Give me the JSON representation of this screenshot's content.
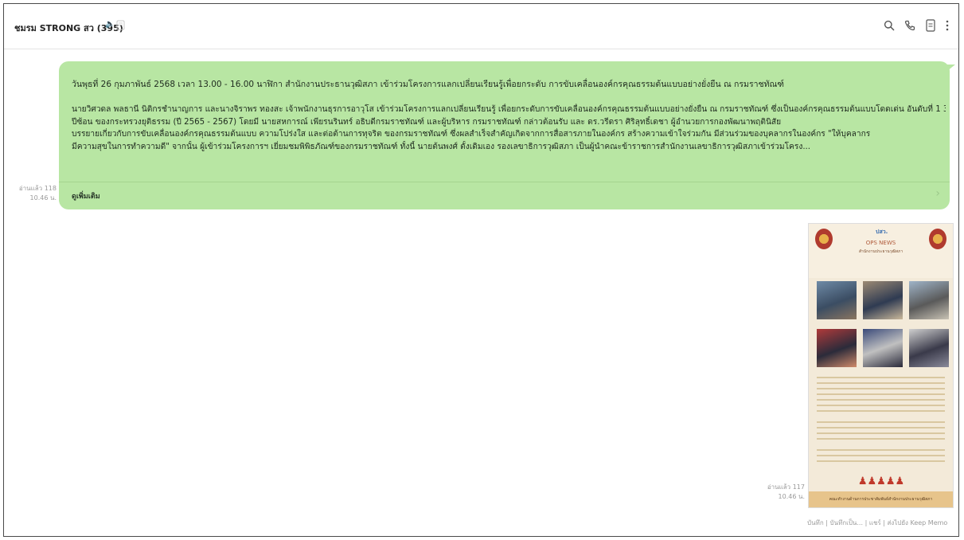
{
  "header": {
    "title": "ชมรม STRONG สว (395)",
    "icons": [
      "search-icon",
      "phone-icon",
      "note-icon",
      "more-icon"
    ]
  },
  "message": {
    "date_line": "วันพุธที่ 26 กุมภาพันธ์ 2568 เวลา 13.00 - 16.00 นาฬิกา สำนักงานประธานวุฒิสภา เข้าร่วมโครงการแลกเปลี่ยนเรียนรู้เพื่อยกระดับ การขับเคลื่อนองค์กรคุณธรรมต้นแบบอย่างยั่งยืน ณ กรมราชทัณฑ์",
    "lines": [
      "นายวิศวดล พลธานี นิติกรชำนาญการ และนางจิราพร ทองสะ เจ้าพนักงานธุรการอาวุโส เข้าร่วมโครงการแลกเปลี่ยนเรียนรู้ เพื่อยกระดับการขับเคลื่อนองค์กรคุณธรรมต้นแบบอย่างยั่งยืน ณ กรมราชทัณฑ์ ซึ่งเป็นองค์กรคุณธรรมต้นแบบโดดเด่น อันดับที่ 1 3",
      "ปีซ้อน ของกระทรวงยุติธรรม (ปี 2565 - 2567) โดยมี นายสหการณ์ เพียรนรินทร์ อธิบดีกรมราชทัณฑ์ และผู้บริหาร กรมราชทัณฑ์ กล่าวต้อนรับ และ ดร.วรีดรา ศิริลุทธิ์เดชา ผู้อำนวยการกองพัฒนาพฤตินิสัย",
      "บรรยายเกี่ยวกับการขับเคลื่อนองค์กรคุณธรรมต้นแบบ ความโปร่งใส และต่อต้านการทุจริต ของกรมราชทัณฑ์ ซึ่งผลสำเร็จสำคัญเกิดจากการสื่อสารภายในองค์กร สร้างความเข้าใจร่วมกัน มีส่วนร่วมของบุคลากรในองค์กร \"ให้บุคลากร",
      "มีความสุขในการทำความดี\" จากนั้น ผู้เข้าร่วมโครงการฯ เยี่ยมชมพิพิธภัณฑ์ของกรมราชทัณฑ์ ทั้งนี้ นายต้นพงศ์ ตั้งเดิมเอง รองเลขาธิการวุฒิสภา เป็นผู้นำคณะข้าราชการสำนักงานเลขาธิการวุฒิสภาเข้าร่วมโครง..."
    ],
    "read_more": "ดูเพิ่มเติม",
    "read_count": "อ่านแล้ว 118",
    "time": "10.46 น."
  },
  "image_message": {
    "poster_logo": "ปสว.",
    "poster_title": "OPS NEWS",
    "poster_subtitle": "สำนักงานประธานวุฒิสภา",
    "poster_footer": "คณะทำงานด้านการประชาสัมพันธ์สำนักงานประธานวุฒิสภา",
    "read_count": "อ่านแล้ว 117",
    "time": "10.46 น."
  },
  "actions": "บันทึก | บันทึกเป็น... | แชร์ | ส่งไปยัง Keep Memo"
}
